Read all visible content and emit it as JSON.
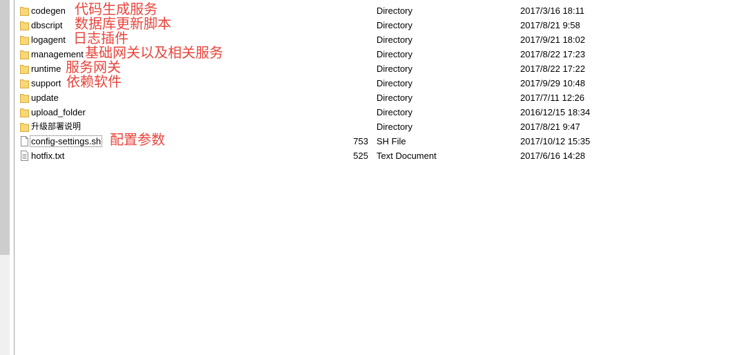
{
  "files": [
    {
      "name": "codegen",
      "size": "",
      "type": "Directory",
      "date": "2017/3/16 18:11",
      "icon": "folder-icon",
      "note": "代码生成服务"
    },
    {
      "name": "dbscript",
      "size": "",
      "type": "Directory",
      "date": "2017/8/21 9:58",
      "icon": "folder-icon",
      "note": "数据库更新脚本"
    },
    {
      "name": "logagent",
      "size": "",
      "type": "Directory",
      "date": "2017/9/21 18:02",
      "icon": "folder-icon",
      "note": "日志插件"
    },
    {
      "name": "management",
      "size": "",
      "type": "Directory",
      "date": "2017/8/22 17:23",
      "icon": "folder-icon",
      "note": "基础网关以及相关服务"
    },
    {
      "name": "runtime",
      "size": "",
      "type": "Directory",
      "date": "2017/8/22 17:22",
      "icon": "folder-icon",
      "note": "服务网关"
    },
    {
      "name": "support",
      "size": "",
      "type": "Directory",
      "date": "2017/9/29 10:48",
      "icon": "folder-icon",
      "note": "依赖软件"
    },
    {
      "name": "update",
      "size": "",
      "type": "Directory",
      "date": "2017/7/11 12:26",
      "icon": "folder-icon",
      "note": ""
    },
    {
      "name": "upload_folder",
      "size": "",
      "type": "Directory",
      "date": "2016/12/15 18:34",
      "icon": "folder-icon",
      "note": ""
    },
    {
      "name": "升级部署说明",
      "size": "",
      "type": "Directory",
      "date": "2017/8/21 9:47",
      "icon": "folder-icon",
      "note": ""
    },
    {
      "name": "config-settings.sh",
      "size": "753",
      "type": "SH File",
      "date": "2017/10/12 15:35",
      "icon": "file-icon",
      "note": "配置参数",
      "selected": true
    },
    {
      "name": "hotfix.txt",
      "size": "525",
      "type": "Text Document",
      "date": "2017/6/16 14:28",
      "icon": "text-file-icon",
      "note": ""
    }
  ],
  "colors": {
    "annotation": "#e8453c",
    "folder": "#f8d775"
  }
}
